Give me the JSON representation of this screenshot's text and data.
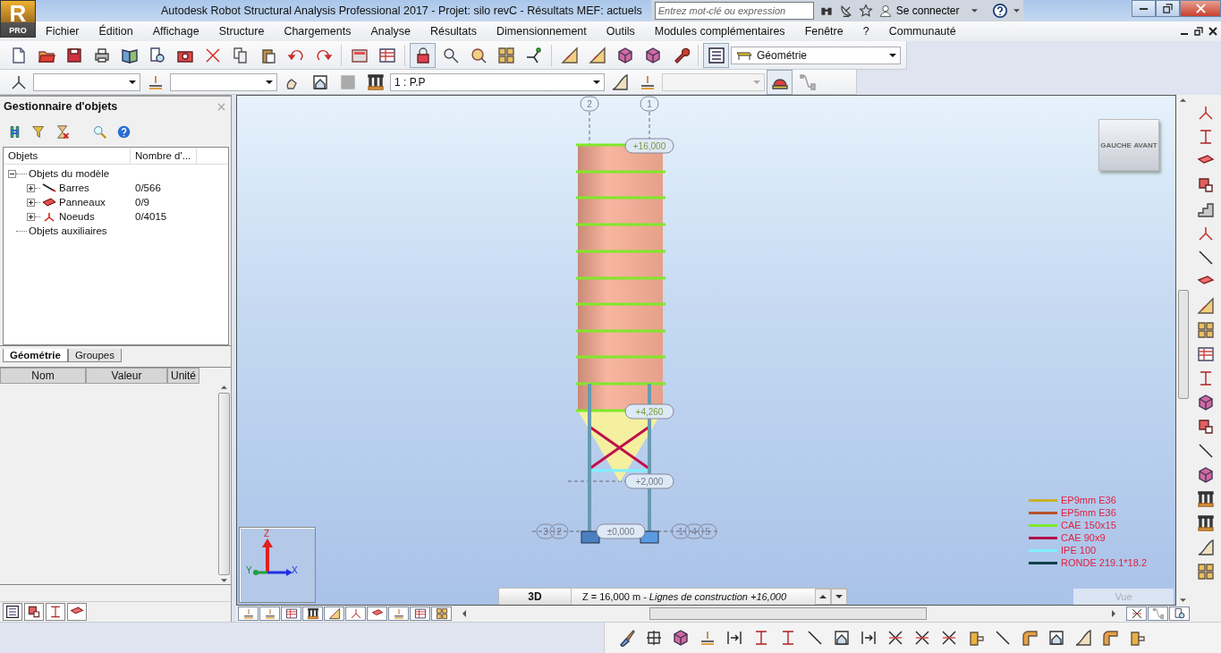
{
  "window": {
    "title": "Autodesk Robot Structural Analysis Professional 2017 - Projet: silo revC - Résultats MEF: actuels",
    "logo_letter": "R",
    "logo_label": "PRO"
  },
  "search": {
    "placeholder": "Entrez mot-clé ou expression"
  },
  "account": {
    "label": "Se connecter"
  },
  "menu": [
    "Fichier",
    "Édition",
    "Affichage",
    "Structure",
    "Chargements",
    "Analyse",
    "Résultats",
    "Dimensionnement",
    "Outils",
    "Modules complémentaires",
    "Fenêtre",
    "?",
    "Communauté"
  ],
  "toolbar": {
    "view_select": "Géométrie",
    "case_select": "1 : P.P"
  },
  "object_manager": {
    "title": "Gestionnaire d'objets",
    "columns": [
      "Objets",
      "Nombre d'..."
    ],
    "tree": [
      {
        "label": "Objets du modèle",
        "expanded": true,
        "children": [
          {
            "label": "Barres",
            "count": "0/566",
            "expanded": false
          },
          {
            "label": "Panneaux",
            "count": "0/9",
            "expanded": false
          },
          {
            "label": "Noeuds",
            "count": "0/4015",
            "expanded": false
          }
        ]
      },
      {
        "label": "Objets auxiliaires"
      }
    ],
    "tabs": [
      {
        "label": "Géométrie",
        "selected": true
      },
      {
        "label": "Groupes",
        "selected": false
      }
    ],
    "properties": {
      "columns": [
        "Nom",
        "Valeur",
        "Unité"
      ]
    }
  },
  "viewport": {
    "grid_labels": [
      "2",
      "1",
      "3",
      "2",
      "1",
      "4",
      "5"
    ],
    "levels": [
      "+16,000",
      "+4,260",
      "+2,000",
      "±0,000"
    ],
    "view_cube": [
      "GAUCHE",
      "AVANT"
    ],
    "axes": [
      "Z",
      "Y",
      "X"
    ],
    "legend": [
      {
        "label": "EP9mm E36",
        "color": "#c8b02a"
      },
      {
        "label": "EP5mm E36",
        "color": "#b5512a"
      },
      {
        "label": "CAE 150x15",
        "color": "#7fe82a"
      },
      {
        "label": "CAE 90x9",
        "color": "#b0104a"
      },
      {
        "label": "IPE 100",
        "color": "#80f0ff"
      },
      {
        "label": "RONDE 219.1*18.2",
        "color": "#10404a"
      }
    ],
    "view_label": "Vue"
  },
  "view_tabs": {
    "mode": "3D",
    "info": "Z = 16,000 m - *Lignes de construction +16,000*"
  }
}
